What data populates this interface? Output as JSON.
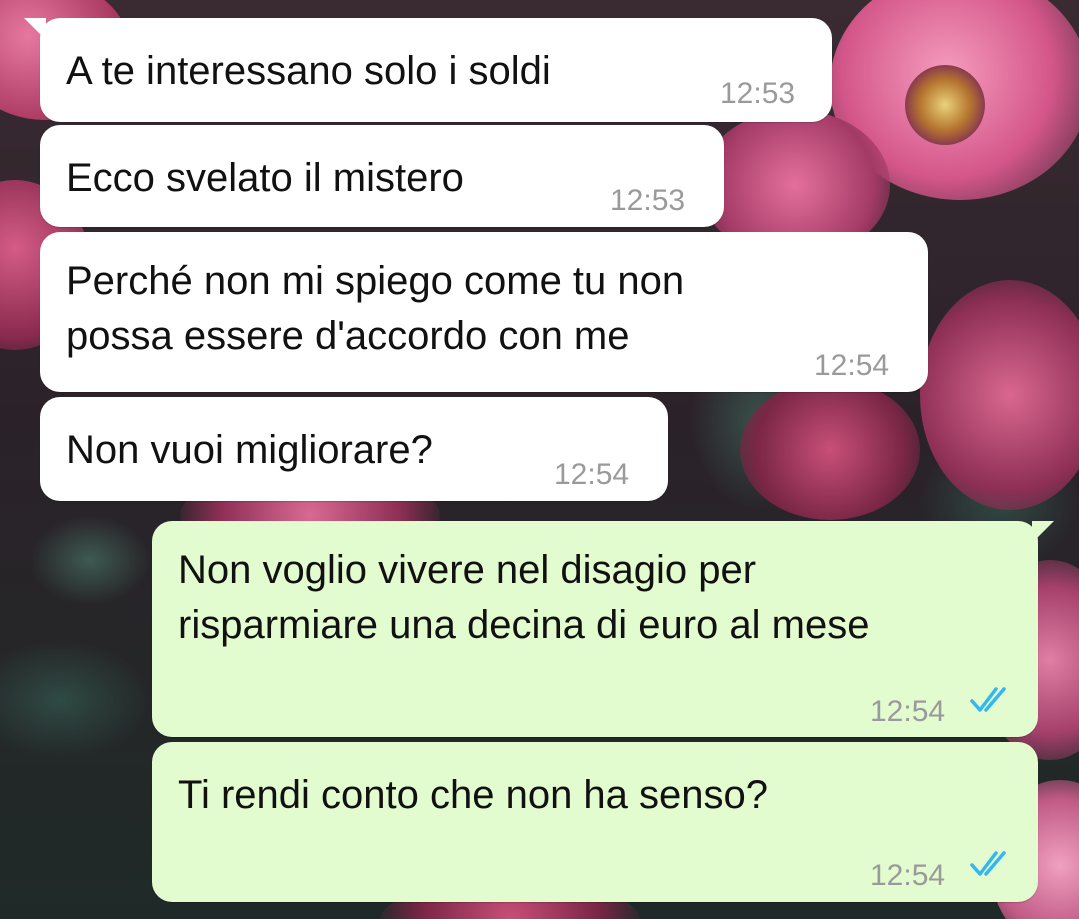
{
  "messages": [
    {
      "direction": "incoming",
      "text": "A te interessano solo i soldi",
      "time": "12:53"
    },
    {
      "direction": "incoming",
      "text": "Ecco svelato il mistero",
      "time": "12:53"
    },
    {
      "direction": "incoming",
      "lines": [
        "Perché non mi spiego come tu non",
        "possa essere d'accordo con me"
      ],
      "time": "12:54"
    },
    {
      "direction": "incoming",
      "text": "Non vuoi migliorare?",
      "time": "12:54"
    },
    {
      "direction": "outgoing",
      "lines": [
        "Non voglio vivere nel disagio per",
        "risparmiare una decina di euro al mese"
      ],
      "time": "12:54",
      "status": "read"
    },
    {
      "direction": "outgoing",
      "text": "Ti rendi conto che non ha senso?",
      "time": "12:54",
      "status": "read"
    }
  ],
  "theme": {
    "incoming_bubble": "#ffffff",
    "outgoing_bubble": "#e2fbcf",
    "read_ticks": "#34b7f1",
    "timestamp": "#9a9a9a",
    "wallpaper": "dark pink roses with green leaves"
  },
  "icons": {
    "read_receipt": "double-check-icon"
  }
}
